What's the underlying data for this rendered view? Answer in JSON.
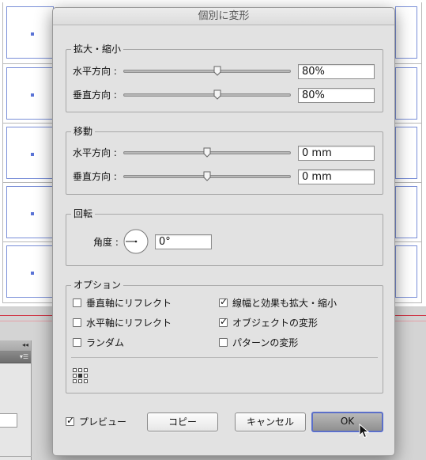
{
  "dialog": {
    "title": "個別に変形"
  },
  "scale": {
    "legend": "拡大・縮小",
    "horizontal_label": "水平方向 :",
    "horizontal_value": "80%",
    "horizontal_slider": 0.56,
    "vertical_label": "垂直方向 :",
    "vertical_value": "80%",
    "vertical_slider": 0.56
  },
  "move": {
    "legend": "移動",
    "horizontal_label": "水平方向 :",
    "horizontal_value": "0 mm",
    "horizontal_slider": 0.5,
    "vertical_label": "垂直方向 :",
    "vertical_value": "0 mm",
    "vertical_slider": 0.5
  },
  "rotate": {
    "legend": "回転",
    "angle_label": "角度 :",
    "angle_value": "0°"
  },
  "options": {
    "legend": "オプション",
    "items": [
      {
        "label": "垂直軸にリフレクト",
        "checked": false
      },
      {
        "label": "水平軸にリフレクト",
        "checked": false
      },
      {
        "label": "ランダム",
        "checked": false
      },
      {
        "label": "線幅と効果も拡大・縮小",
        "checked": true
      },
      {
        "label": "オブジェクトの変形",
        "checked": true
      },
      {
        "label": "パターンの変形",
        "checked": false
      }
    ]
  },
  "footer": {
    "preview_label": "プレビュー",
    "preview_checked": true,
    "copy_label": "コピー",
    "cancel_label": "キャンセル",
    "ok_label": "OK"
  },
  "colors": {
    "accent": "#5b6fc9",
    "artboard_guide": "#d03a4a",
    "selection": "#5a73d6"
  },
  "icons": {
    "check": "✓",
    "panel_collapse": "◂◂",
    "panel_menu": "▾☰"
  }
}
